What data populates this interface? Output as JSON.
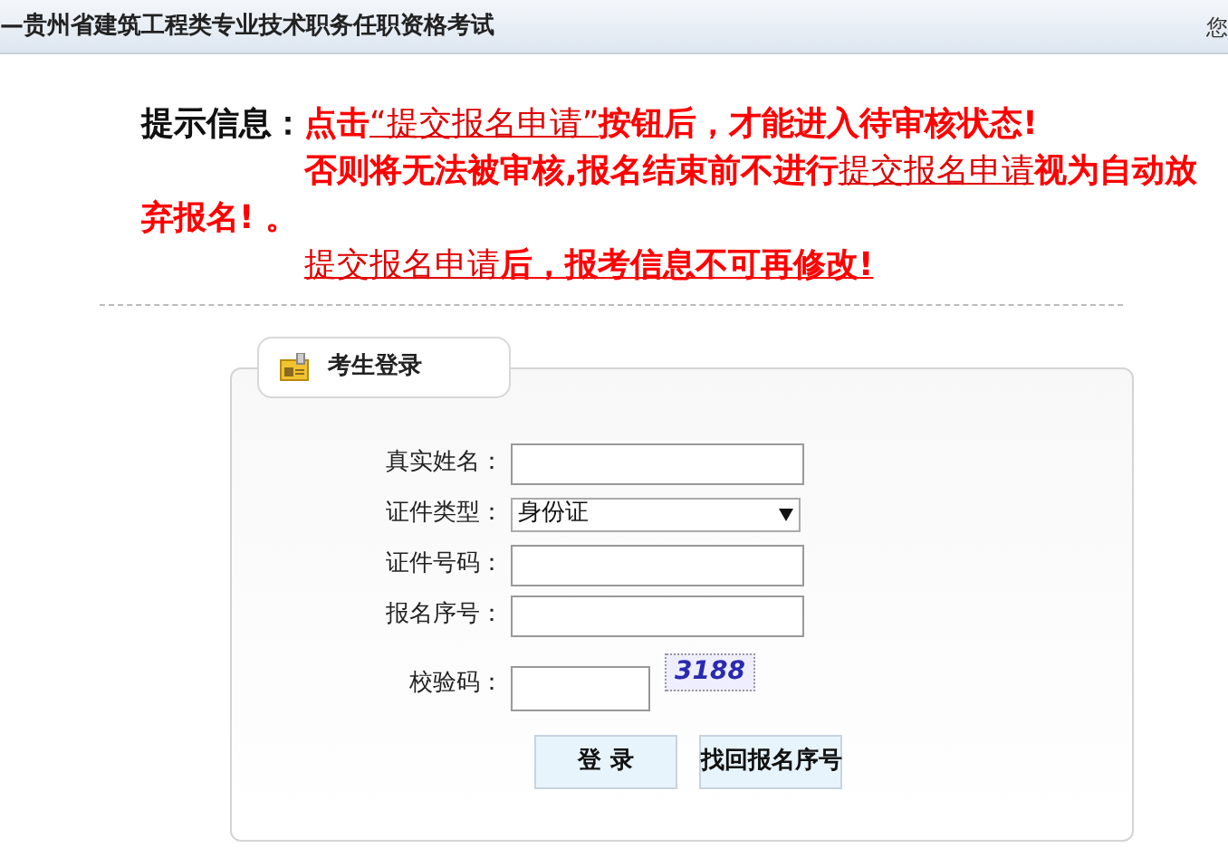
{
  "header": {
    "title": "—贵州省建筑工程类专业技术职务任职资格考试",
    "right_text": "您"
  },
  "notice": {
    "heading": "提示信息：",
    "paragraphs": [
      [
        {
          "text": "点击",
          "link": false,
          "underline": false
        },
        {
          "text": "“提交报名申请”",
          "link": true,
          "underline": true
        },
        {
          "text": "按钮后，才能进入待审核状态!",
          "link": false,
          "underline": false
        }
      ],
      [
        {
          "text": "否则将无法被审核,报名结束前不进行",
          "link": false,
          "underline": false
        },
        {
          "text": "提交报名申请",
          "link": true,
          "underline": true
        },
        {
          "text": "视为自动放弃报名! 。",
          "link": false,
          "underline": false
        }
      ],
      [
        {
          "text": "提交报名申请",
          "link": true,
          "underline": true
        },
        {
          "text": "后，报考信息不可再修改!",
          "link": false,
          "underline": true
        }
      ]
    ]
  },
  "login": {
    "tab": "考生登录",
    "fields": [
      {
        "label": "真实姓名：",
        "kind": "text"
      },
      {
        "label": "证件类型：",
        "kind": "select",
        "value": "身份证"
      },
      {
        "label": "证件号码：",
        "kind": "text"
      },
      {
        "label": "报名序号：",
        "kind": "text"
      },
      {
        "label": "校验码：",
        "kind": "captcha",
        "captcha": "3188"
      }
    ],
    "buttons": [
      "登 录",
      "找回报名序号"
    ]
  }
}
